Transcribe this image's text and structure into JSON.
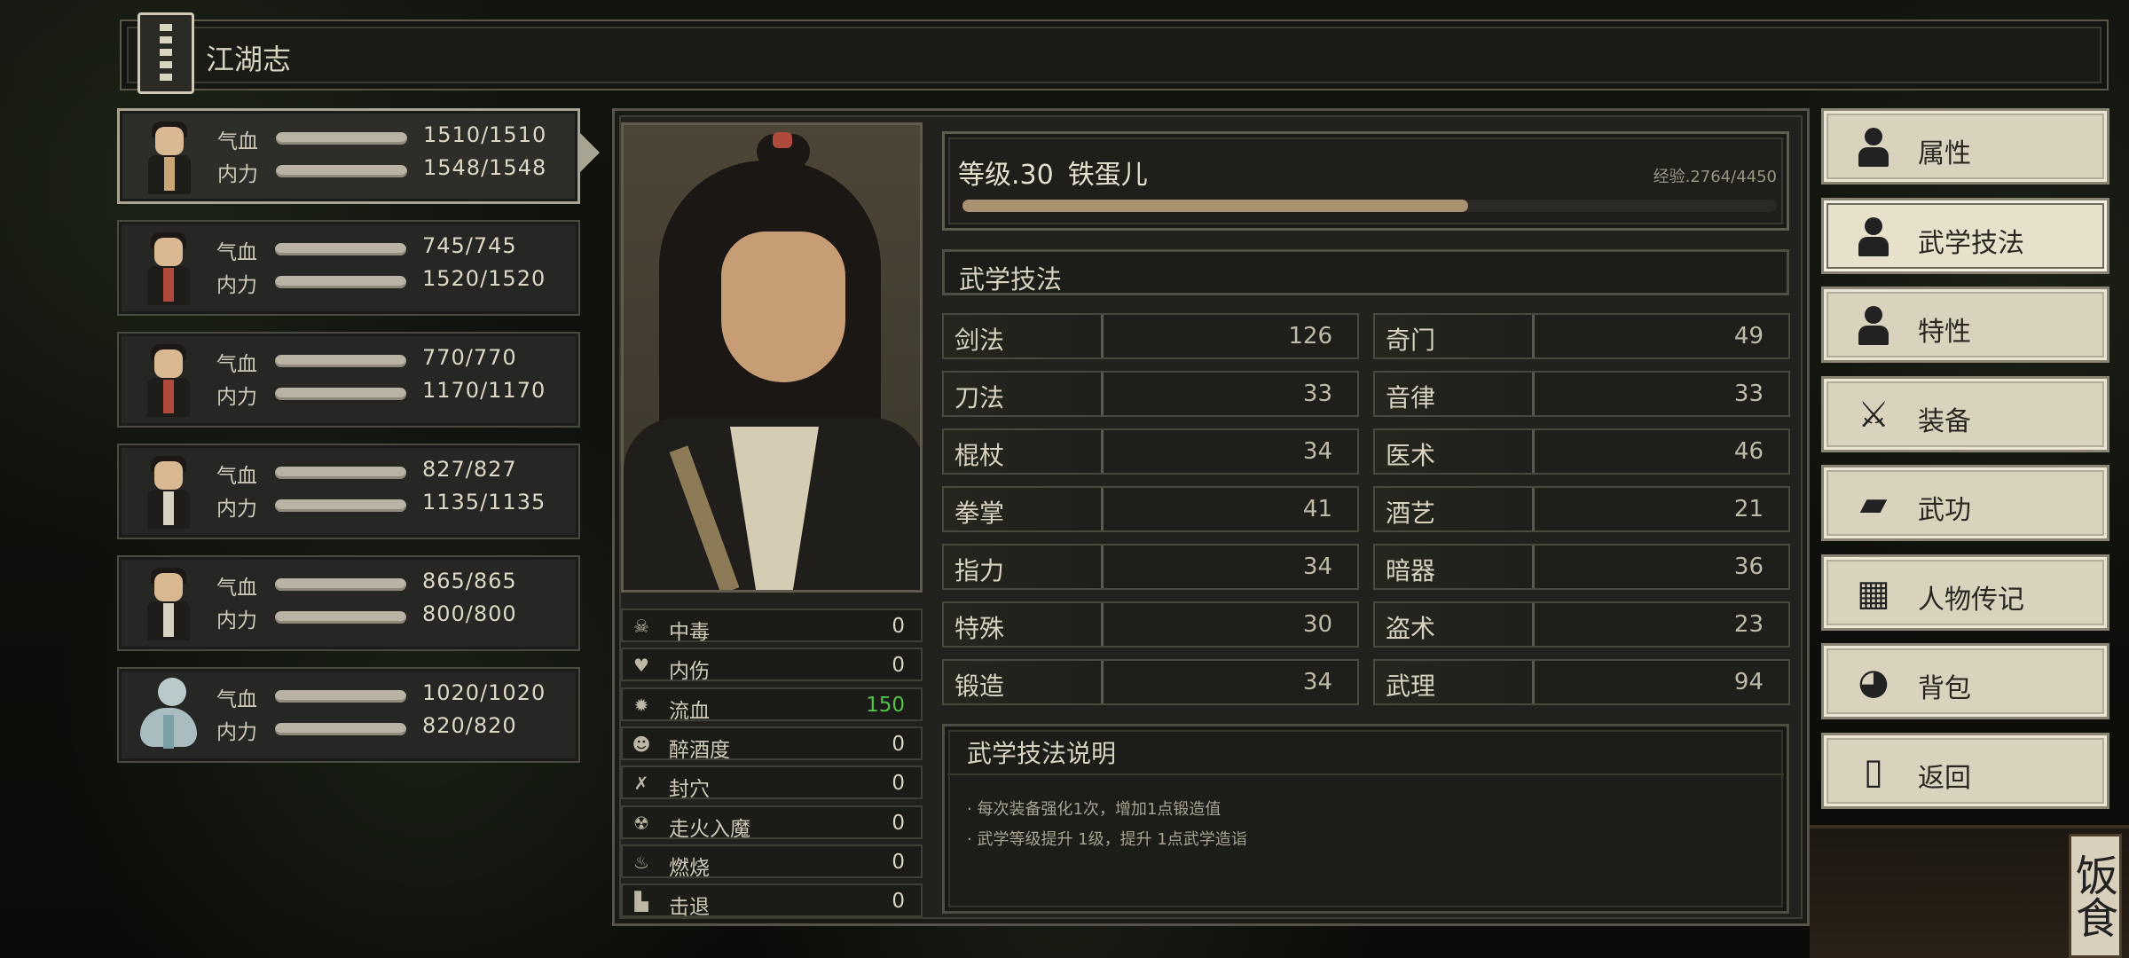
{
  "title": "江湖志",
  "party": [
    {
      "hp_label": "气血",
      "mp_label": "内力",
      "hp": "1510/1510",
      "mp": "1548/1548",
      "hp_frac": 1.0,
      "mp_frac": 1.0,
      "active": true
    },
    {
      "hp_label": "气血",
      "mp_label": "内力",
      "hp": "745/745",
      "mp": "1520/1520",
      "hp_frac": 1.0,
      "mp_frac": 1.0,
      "active": false
    },
    {
      "hp_label": "气血",
      "mp_label": "内力",
      "hp": "770/770",
      "mp": "1170/1170",
      "hp_frac": 1.0,
      "mp_frac": 1.0,
      "active": false
    },
    {
      "hp_label": "气血",
      "mp_label": "内力",
      "hp": "827/827",
      "mp": "1135/1135",
      "hp_frac": 1.0,
      "mp_frac": 1.0,
      "active": false
    },
    {
      "hp_label": "气血",
      "mp_label": "内力",
      "hp": "865/865",
      "mp": "800/800",
      "hp_frac": 1.0,
      "mp_frac": 1.0,
      "active": false
    },
    {
      "hp_label": "气血",
      "mp_label": "内力",
      "hp": "1020/1020",
      "mp": "820/820",
      "hp_frac": 1.0,
      "mp_frac": 1.0,
      "active": false
    }
  ],
  "character": {
    "level_text": "等级.30",
    "name": "铁蛋儿",
    "exp_text": "经验.2764/4450",
    "exp_current": 2764,
    "exp_max": 4450
  },
  "status_effects": [
    {
      "icon": "skull-icon",
      "glyph": "☠",
      "name": "中毒",
      "value": "0",
      "color": "#d8d2c0"
    },
    {
      "icon": "broken-heart-icon",
      "glyph": "♥",
      "name": "内伤",
      "value": "0",
      "color": "#d8d2c0"
    },
    {
      "icon": "bleed-icon",
      "glyph": "✹",
      "name": "流血",
      "value": "150",
      "color": "#52c146"
    },
    {
      "icon": "drunk-icon",
      "glyph": "☻",
      "name": "醉酒度",
      "value": "0",
      "color": "#d8d2c0"
    },
    {
      "icon": "seal-icon",
      "glyph": "✗",
      "name": "封穴",
      "value": "0",
      "color": "#d8d2c0"
    },
    {
      "icon": "demon-icon",
      "glyph": "☢",
      "name": "走火入魔",
      "value": "0",
      "color": "#d8d2c0"
    },
    {
      "icon": "fire-icon",
      "glyph": "♨",
      "name": "燃烧",
      "value": "0",
      "color": "#d8d2c0"
    },
    {
      "icon": "boot-icon",
      "glyph": "▙",
      "name": "击退",
      "value": "0",
      "color": "#d8d2c0"
    }
  ],
  "skills_section_title": "武学技法",
  "skills_left": [
    {
      "name": "剑法",
      "value": "126"
    },
    {
      "name": "刀法",
      "value": "33"
    },
    {
      "name": "棍杖",
      "value": "34"
    },
    {
      "name": "拳掌",
      "value": "41"
    },
    {
      "name": "指力",
      "value": "34"
    },
    {
      "name": "特殊",
      "value": "30"
    },
    {
      "name": "锻造",
      "value": "34"
    }
  ],
  "skills_right": [
    {
      "name": "奇门",
      "value": "49"
    },
    {
      "name": "音律",
      "value": "33"
    },
    {
      "name": "医术",
      "value": "46"
    },
    {
      "name": "酒艺",
      "value": "21"
    },
    {
      "name": "暗器",
      "value": "36"
    },
    {
      "name": "盗术",
      "value": "23"
    },
    {
      "name": "武理",
      "value": "94"
    }
  ],
  "description": {
    "title": "武学技法说明",
    "lines": [
      "· 每次装备强化1次，增加1点锻造值",
      "· 武学等级提升 1级，提升 1点武学造诣"
    ]
  },
  "menu": [
    {
      "label": "属性",
      "icon": "person-icon",
      "glyph": "",
      "selected": false
    },
    {
      "label": "武学技法",
      "icon": "person-aura-icon",
      "glyph": "",
      "selected": true
    },
    {
      "label": "特性",
      "icon": "person-heart-icon",
      "glyph": "",
      "selected": false
    },
    {
      "label": "装备",
      "icon": "sword-icon",
      "glyph": "⚔",
      "selected": false
    },
    {
      "label": "武功",
      "icon": "book-icon",
      "glyph": "▰",
      "selected": false
    },
    {
      "label": "人物传记",
      "icon": "scroll-icon",
      "glyph": "▦",
      "selected": false
    },
    {
      "label": "背包",
      "icon": "bag-icon",
      "glyph": "◕",
      "selected": false
    },
    {
      "label": "返回",
      "icon": "door-icon",
      "glyph": "▯",
      "selected": false
    }
  ],
  "background_sign": "饭食"
}
